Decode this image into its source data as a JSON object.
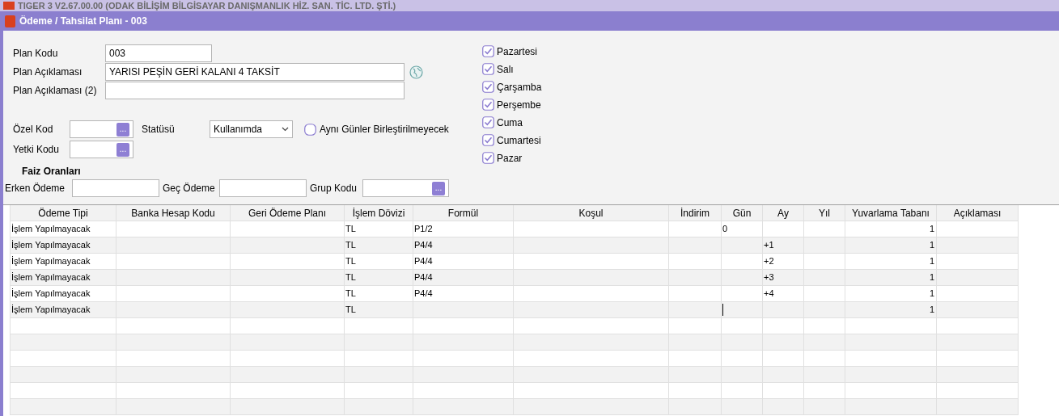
{
  "app_title": "TIGER 3 V2.67.00.00 (ODAK BİLİŞİM BİLGİSAYAR DANIŞMANLIK HİZ. SAN. TİC. LTD. ŞTİ.)",
  "window": {
    "title": "Ödeme / Tahsilat Planı - 003"
  },
  "form": {
    "plan_kodu": {
      "label": "Plan Kodu",
      "value": "003"
    },
    "plan_aciklamasi": {
      "label": "Plan Açıklaması",
      "value": "YARISI PEŞİN GERİ KALANI 4 TAKSİT"
    },
    "plan_aciklamasi_2": {
      "label": "Plan Açıklaması (2)"
    },
    "ozel_kod": {
      "label": "Özel Kod",
      "button": "..."
    },
    "statusu": {
      "label": "Statüsü",
      "value": "Kullanımda"
    },
    "ayni_gunler": {
      "label": "Aynı Günler Birleştirilmeyecek",
      "checked": false
    },
    "yetki_kodu": {
      "label": "Yetki Kodu",
      "button": "..."
    },
    "faiz_title": "Faiz Oranları",
    "erken_odeme": {
      "label": "Erken Ödeme"
    },
    "gec_odeme": {
      "label": "Geç Ödeme"
    },
    "grup_kodu": {
      "label": "Grup Kodu",
      "button": "..."
    }
  },
  "days": [
    {
      "label": "Pazartesi",
      "checked": true
    },
    {
      "label": "Salı",
      "checked": true
    },
    {
      "label": "Çarşamba",
      "checked": true
    },
    {
      "label": "Perşembe",
      "checked": true
    },
    {
      "label": "Cuma",
      "checked": true
    },
    {
      "label": "Cumartesi",
      "checked": true
    },
    {
      "label": "Pazar",
      "checked": true
    }
  ],
  "table": {
    "columns": [
      "Ödeme Tipi",
      "Banka Hesap Kodu",
      "Geri Ödeme Planı",
      "İşlem Dövizi",
      "Formül",
      "Koşul",
      "İndirim",
      "Gün",
      "Ay",
      "Yıl",
      "Yuvarlama Tabanı",
      "Açıklaması"
    ],
    "rows": [
      [
        "İşlem Yapılmayacak",
        null,
        null,
        "TL",
        "P1/2",
        null,
        null,
        "0",
        null,
        null,
        "1",
        null
      ],
      [
        "İşlem Yapılmayacak",
        null,
        null,
        "TL",
        "P4/4",
        null,
        null,
        null,
        "+1",
        null,
        "1",
        null
      ],
      [
        "İşlem Yapılmayacak",
        null,
        null,
        "TL",
        "P4/4",
        null,
        null,
        null,
        "+2",
        null,
        "1",
        null
      ],
      [
        "İşlem Yapılmayacak",
        null,
        null,
        "TL",
        "P4/4",
        null,
        null,
        null,
        "+3",
        null,
        "1",
        null
      ],
      [
        "İşlem Yapılmayacak",
        null,
        null,
        "TL",
        "P4/4",
        null,
        null,
        null,
        "+4",
        null,
        "1",
        null
      ],
      [
        "İşlem Yapılmayacak",
        null,
        null,
        "TL",
        null,
        null,
        null,
        null,
        null,
        null,
        "1",
        null
      ]
    ]
  }
}
